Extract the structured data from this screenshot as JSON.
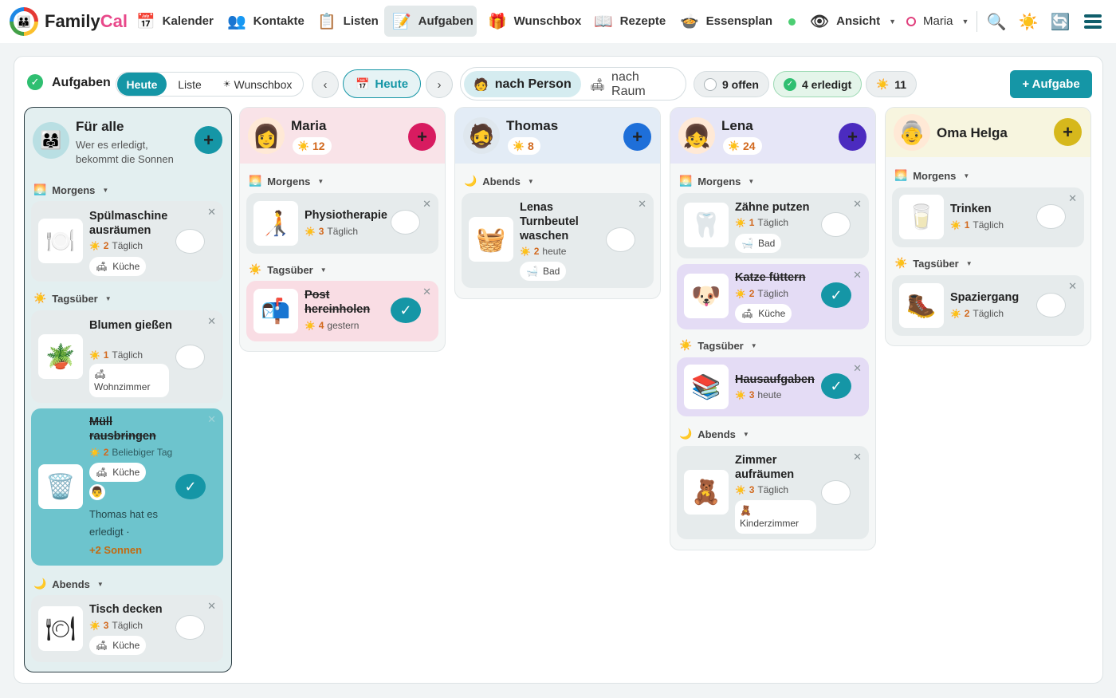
{
  "nav": {
    "brand_family": "Family",
    "brand_cal": "Cal",
    "items": [
      {
        "label": "Kalender",
        "icon": "calendar-icon"
      },
      {
        "label": "Kontakte",
        "icon": "contacts-icon"
      },
      {
        "label": "Listen",
        "icon": "list-icon"
      },
      {
        "label": "Aufgaben",
        "icon": "tasks-icon"
      },
      {
        "label": "Wunschbox",
        "icon": "gift-icon"
      },
      {
        "label": "Rezepte",
        "icon": "recipe-book-icon"
      },
      {
        "label": "Essensplan",
        "icon": "meal-plan-icon"
      }
    ],
    "view_label": "Ansicht",
    "user_label": "Maria"
  },
  "toolbar": {
    "title": "Aufgaben",
    "seg": [
      "Heute",
      "Liste",
      "Wunschbox"
    ],
    "today": "Heute",
    "prev": "‹",
    "next": "›",
    "group_person": "nach Person",
    "group_room": "nach Raum",
    "open": "9 offen",
    "done": "4 erledigt",
    "suns": "11",
    "add": "+ Aufgabe"
  },
  "colors": {
    "accent": "#1596a6",
    "maria": "#d81b60",
    "thomas": "#1e6fd9",
    "lena": "#4b2bbf",
    "helga": "#d6b81c"
  },
  "columns": {
    "all": {
      "name": "Für alle",
      "subtitle": "Wer es erledigt, bekommt die Sonnen",
      "sec1": "Morgens",
      "sec2": "Tagsüber",
      "sec3": "Abends",
      "t1": {
        "title": "Spülmaschine ausräumen",
        "pts": "2",
        "freq": "Täglich",
        "room": "Küche"
      },
      "t2": {
        "title": "Blumen gießen",
        "pts": "1",
        "freq": "Täglich",
        "room": "Wohnzimmer"
      },
      "t3": {
        "title": "Müll rausbringen",
        "pts": "2",
        "freq": "Beliebiger Tag",
        "room": "Küche",
        "done_by": "Thomas hat es erledigt ·",
        "bonus": "+2 Sonnen"
      },
      "t4": {
        "title": "Tisch decken",
        "pts": "3",
        "freq": "Täglich",
        "room": "Küche"
      }
    },
    "maria": {
      "name": "Maria",
      "suns": "12",
      "sec1": "Morgens",
      "sec2": "Tagsüber",
      "t1": {
        "title": "Physiotherapie",
        "pts": "3",
        "freq": "Täglich"
      },
      "t2": {
        "title": "Post hereinholen",
        "pts": "4",
        "freq": "gestern"
      }
    },
    "thomas": {
      "name": "Thomas",
      "suns": "8",
      "sec1": "Abends",
      "t1": {
        "title": "Lenas Turnbeutel waschen",
        "pts": "2",
        "freq": "heute",
        "room": "Bad"
      }
    },
    "lena": {
      "name": "Lena",
      "suns": "24",
      "sec1": "Morgens",
      "sec2": "Tagsüber",
      "sec3": "Abends",
      "t1": {
        "title": "Zähne putzen",
        "pts": "1",
        "freq": "Täglich",
        "room": "Bad"
      },
      "t2": {
        "title": "Katze füttern",
        "pts": "2",
        "freq": "Täglich",
        "room": "Küche"
      },
      "t3": {
        "title": "Hausaufgaben",
        "pts": "3",
        "freq": "heute"
      },
      "t4": {
        "title": "Zimmer aufräumen",
        "pts": "3",
        "freq": "Täglich",
        "room": "Kinderzimmer"
      }
    },
    "helga": {
      "name": "Oma Helga",
      "sec1": "Morgens",
      "sec2": "Tagsüber",
      "t1": {
        "title": "Trinken",
        "pts": "1",
        "freq": "Täglich"
      },
      "t2": {
        "title": "Spaziergang",
        "pts": "2",
        "freq": "Täglich"
      }
    }
  }
}
